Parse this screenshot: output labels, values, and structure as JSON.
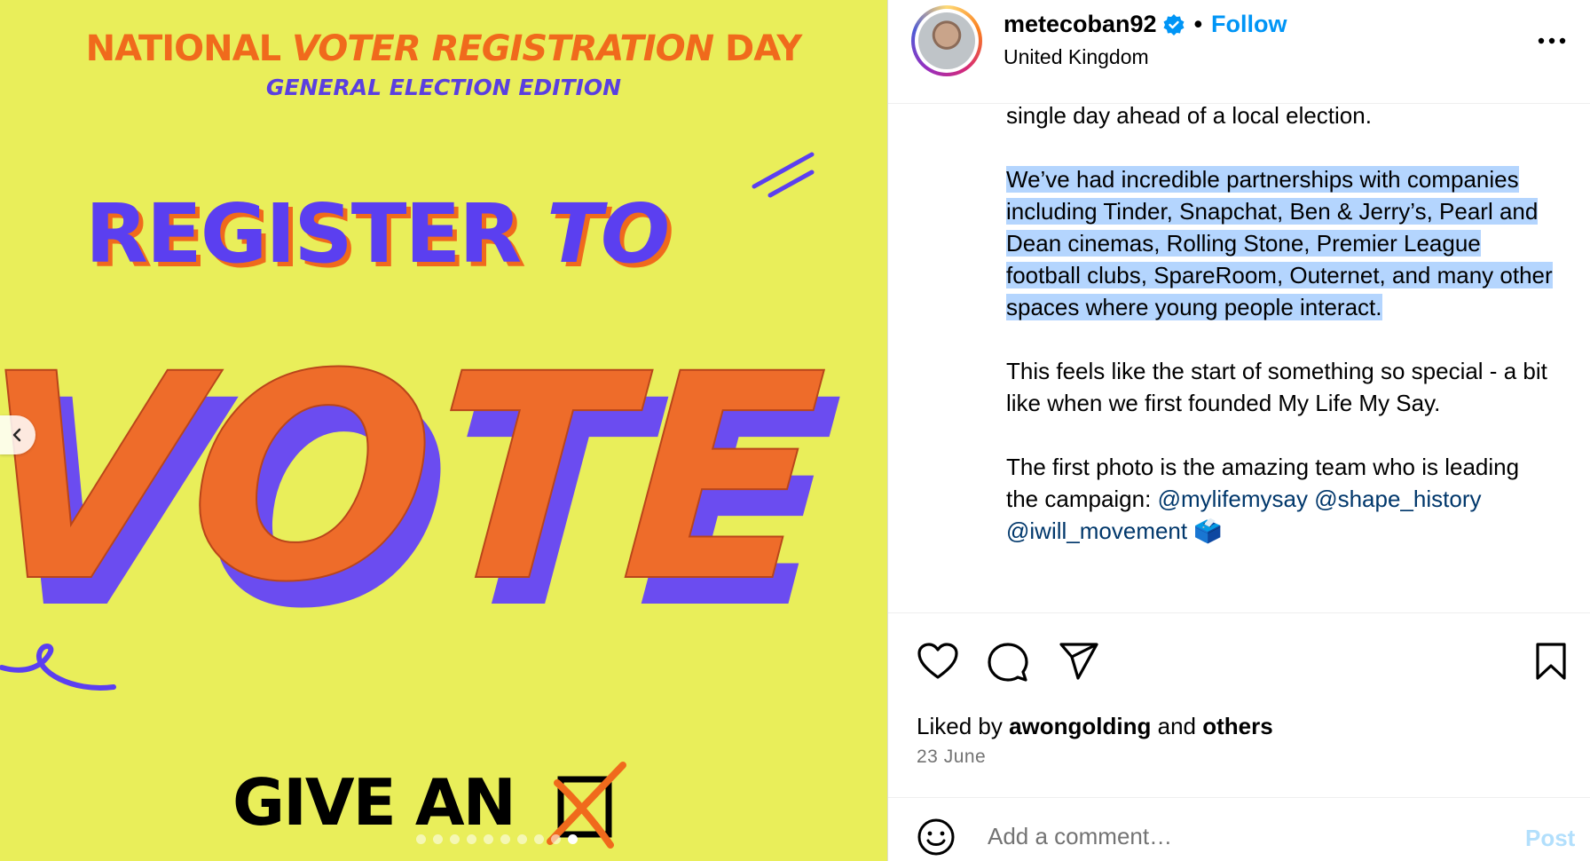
{
  "poster": {
    "line1_a": "NATIONAL",
    "line1_b": "VOTER REGISTRATION",
    "line1_c": "DAY",
    "line2": "GENERAL ELECTION EDITION",
    "register": "REGISTER",
    "to": "TO",
    "vote": "VOTE",
    "bottom": "GIVE AN",
    "slide_count": 10,
    "active_slide": 10
  },
  "header": {
    "username": "metecoban92",
    "separator": "•",
    "follow_label": "Follow",
    "location": "United Kingdom"
  },
  "caption": {
    "paragraph1_tail": "single day ahead of a local election.",
    "paragraph2": "We’ve had incredible partnerships with companies including Tinder, Snapchat, Ben & Jerry’s, Pearl and Dean cinemas, Rolling Stone, Premier League football clubs, SpareRoom, Outernet, and many other spaces where young people interact.",
    "paragraph3": "This feels like the start of something so special - a bit like when we first founded My Life My Say.",
    "paragraph4_text": "The first photo is the amazing team who is leading the campaign: ",
    "mention1": "@mylifemysay",
    "mention2": "@shape_history",
    "mention3": "@iwill_movement",
    "emoji": "🗳️"
  },
  "actions": {
    "liked_by_prefix": "Liked by ",
    "liked_by_user": "awongolding",
    "liked_by_and": " and ",
    "liked_by_others": "others",
    "date": "23 June"
  },
  "comment": {
    "placeholder": "Add a comment…",
    "post_label": "Post"
  },
  "colors": {
    "poster_bg": "#e9ee5a",
    "poster_orange": "#f06a1c",
    "poster_purple": "#5b3ff0",
    "follow_blue": "#0095f6",
    "mention_blue": "#00376b",
    "selection": "#b4d5fe"
  },
  "icons": [
    "chevron-left-icon",
    "verified-badge-icon",
    "more-options-icon",
    "heart-icon",
    "comment-icon",
    "share-icon",
    "bookmark-icon",
    "emoji-icon"
  ]
}
